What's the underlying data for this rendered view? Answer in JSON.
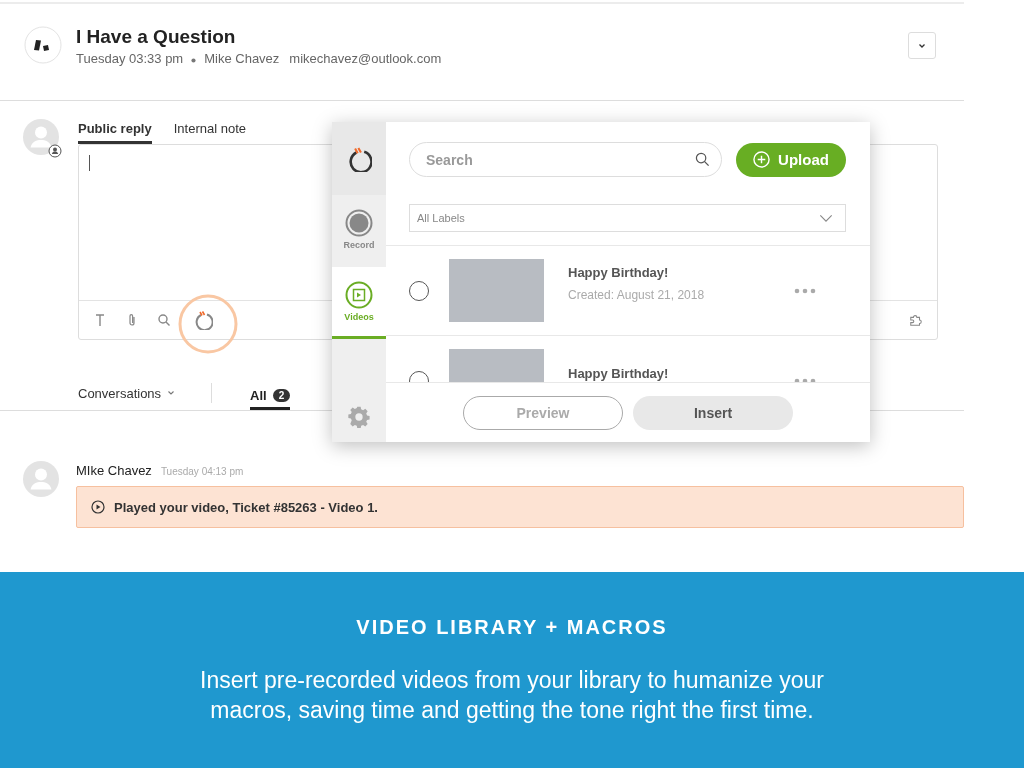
{
  "ticket": {
    "title": "I Have a Question",
    "time": "Tuesday 03:33 pm",
    "requester": "Mike Chavez",
    "email": "mikechavez@outlook.com"
  },
  "reply_tabs": [
    {
      "label": "Public reply",
      "selected": true
    },
    {
      "label": "Internal note",
      "selected": false
    }
  ],
  "filter": {
    "conversations": "Conversations",
    "all_label": "All",
    "all_count": "2"
  },
  "message": {
    "author": "MIke Chavez",
    "time": "Tuesday 04:13 pm",
    "event": "Played your video, Ticket #85263 - Video 1."
  },
  "video_panel": {
    "nav": [
      {
        "kind": "record",
        "label": "Record",
        "selected": false
      },
      {
        "kind": "videos",
        "label": "Videos",
        "selected": true
      }
    ],
    "search": {
      "placeholder": "Search"
    },
    "upload": "Upload",
    "labels": "All Labels",
    "videos": [
      {
        "title": "Happy Birthday!",
        "created": "Created: August 21, 2018",
        "selected": false
      },
      {
        "title": "Happy Birthday!",
        "selected": false
      }
    ],
    "preview": "Preview",
    "insert": "Insert"
  },
  "banner": {
    "heading": "VIDEO LIBRARY + MACROS",
    "text": "Insert pre-recorded videos from your library to humanize your macros, saving time and getting the tone right the first time."
  }
}
